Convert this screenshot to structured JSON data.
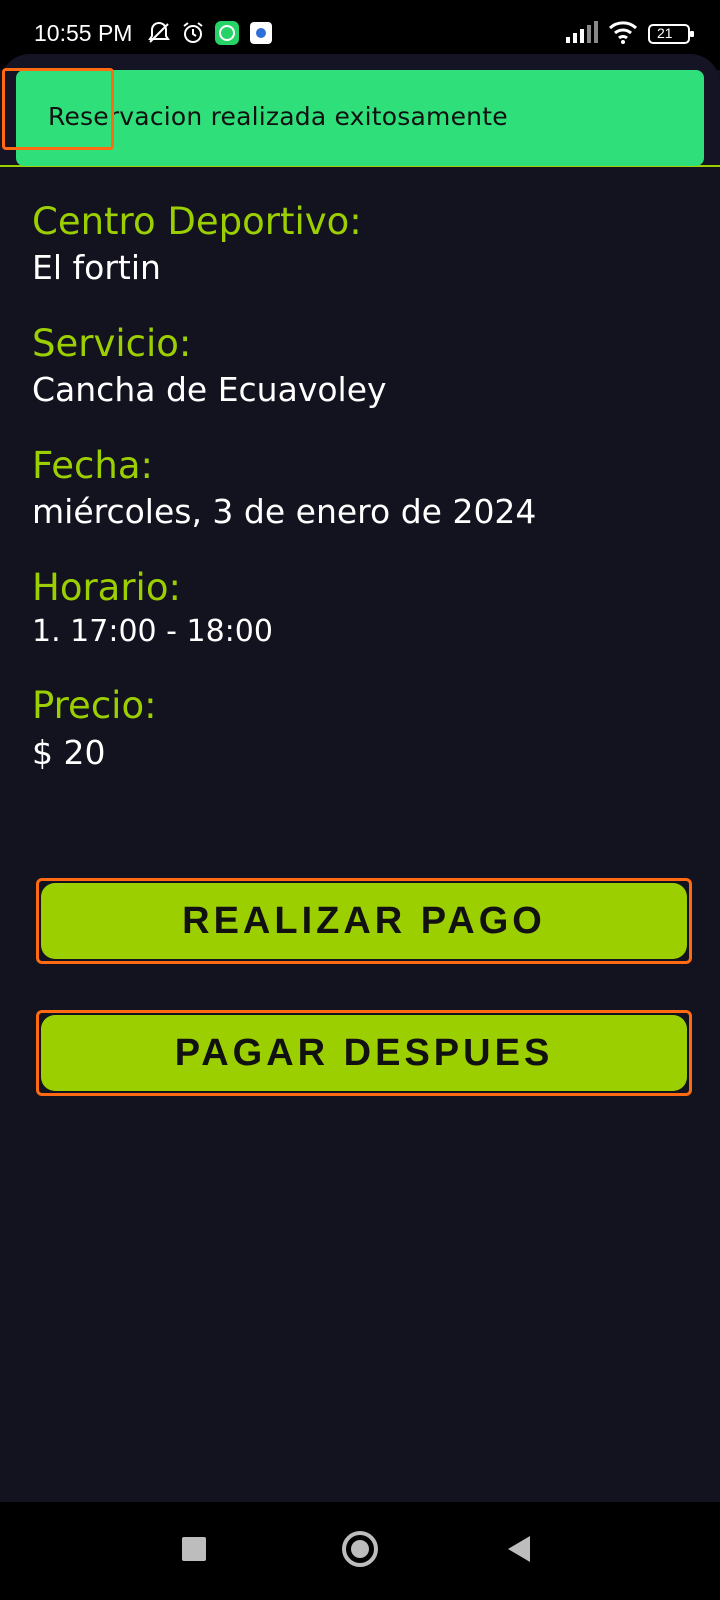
{
  "status_bar": {
    "time": "10:55 PM",
    "battery": "21",
    "icons_left": [
      "muted-bell-icon",
      "alarm-icon",
      "whatsapp-icon",
      "app-icon"
    ],
    "icons_right": [
      "signal-icon",
      "wifi-icon",
      "battery-icon"
    ]
  },
  "snackbar": {
    "message": "Reservacion realizada exitosamente",
    "color": "#2fe07a"
  },
  "details": {
    "center_label": "Centro Deportivo:",
    "center_value": "El fortin",
    "service_label": "Servicio:",
    "service_value": "Cancha de Ecuavoley",
    "date_label": "Fecha:",
    "date_value": "miércoles, 3 de enero de 2024",
    "time_label": "Horario:",
    "time_value": "1. 17:00 - 18:00",
    "price_label": "Precio:",
    "price_value": "$ 20"
  },
  "buttons": {
    "pay_label": "REALIZAR PAGO",
    "later_label": "PAGAR DESPUES"
  },
  "colors": {
    "background": "#13121f",
    "accent": "#9ccf00",
    "highlight": "#ff6a13"
  },
  "nav": {
    "icons": [
      "recent-apps-icon",
      "home-icon",
      "back-icon"
    ]
  }
}
